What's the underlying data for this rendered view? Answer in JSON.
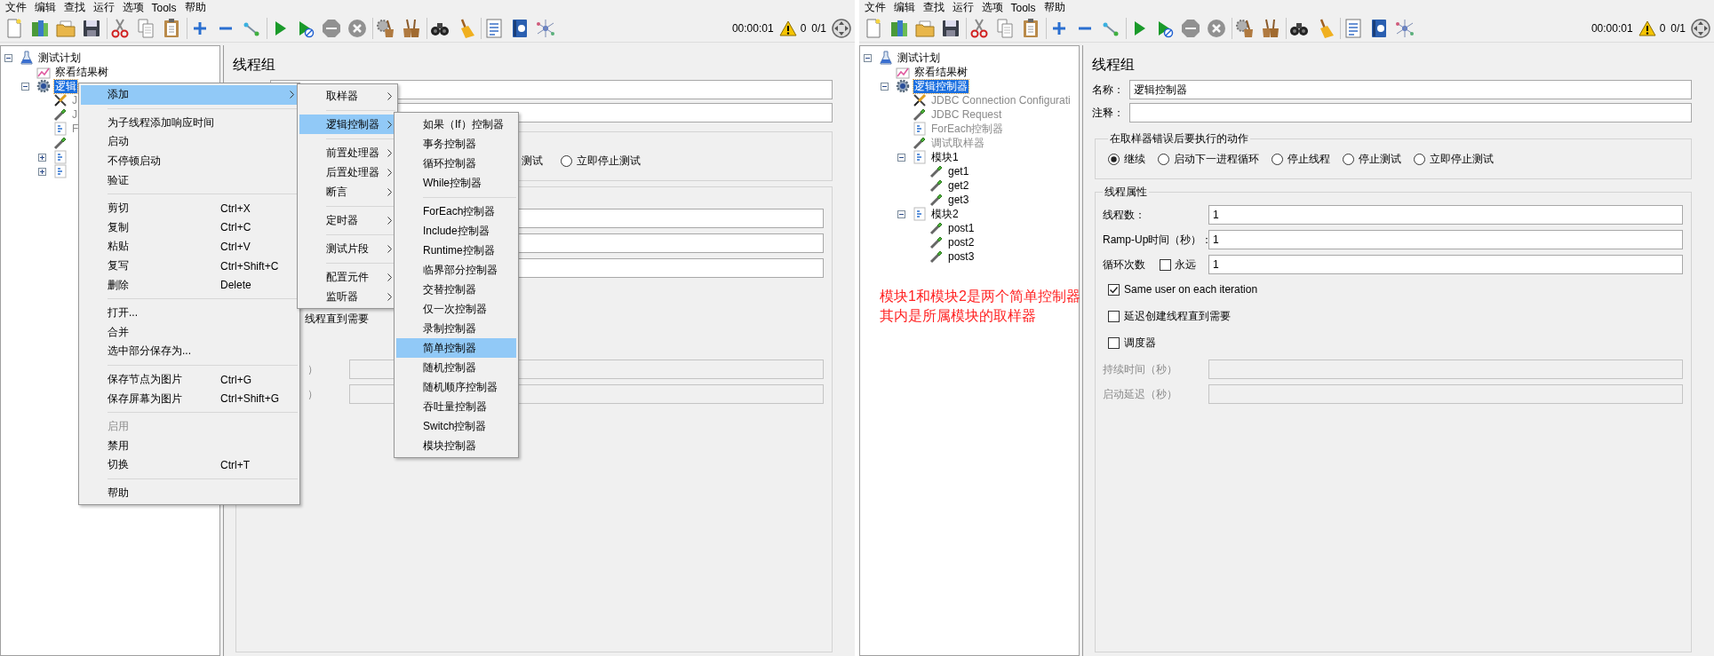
{
  "windows": [
    {
      "menu_bar": [
        "文件",
        "编辑",
        "查找",
        "运行",
        "选项",
        "Tools",
        "帮助"
      ],
      "toolbar": [
        {
          "kind": "new",
          "disabled": false
        },
        {
          "kind": "templates",
          "disabled": false
        },
        {
          "kind": "open",
          "disabled": false
        },
        {
          "kind": "save",
          "disabled": false
        },
        {
          "kind": "separator"
        },
        {
          "kind": "cut",
          "disabled": false
        },
        {
          "kind": "copy",
          "disabled": false
        },
        {
          "kind": "paste",
          "disabled": false
        },
        {
          "kind": "separator"
        },
        {
          "kind": "add",
          "disabled": false
        },
        {
          "kind": "remove",
          "disabled": false
        },
        {
          "kind": "toggle",
          "disabled": false
        },
        {
          "kind": "separator"
        },
        {
          "kind": "start",
          "disabled": false
        },
        {
          "kind": "start_no_pause",
          "disabled": false
        },
        {
          "kind": "stop",
          "disabled": true
        },
        {
          "kind": "shutdown",
          "disabled": true
        },
        {
          "kind": "separator"
        },
        {
          "kind": "clear",
          "disabled": false
        },
        {
          "kind": "clear_all",
          "disabled": false
        },
        {
          "kind": "separator"
        },
        {
          "kind": "search",
          "disabled": false
        },
        {
          "kind": "reset_search",
          "disabled": false
        },
        {
          "kind": "separator"
        },
        {
          "kind": "function_helper",
          "disabled": false
        },
        {
          "kind": "help",
          "disabled": false
        },
        {
          "kind": "network",
          "disabled": false
        }
      ],
      "timer": "00:00:01",
      "error_count": "0",
      "thread_count": "0/1",
      "tree": [
        {
          "label": "测试计划",
          "kind": "plan",
          "expanded": true,
          "selected": false,
          "disabled": false,
          "children": [
            {
              "label": "察看结果树",
              "kind": "listener",
              "selected": false,
              "disabled": false
            },
            {
              "label": "逻辑",
              "kind": "group",
              "expanded": true,
              "selected": true,
              "disabled": false,
              "children": [
                {
                  "label": "J",
                  "kind": "config",
                  "selected": false,
                  "disabled": true
                },
                {
                  "label": "J",
                  "kind": "sampler",
                  "selected": false,
                  "disabled": true
                },
                {
                  "label": "F",
                  "kind": "controller",
                  "selected": false,
                  "disabled": true
                },
                {
                  "kind": "sampler"
                },
                {
                  "kind": "controller",
                  "expanded": false
                },
                {
                  "kind": "controller",
                  "expanded": false
                }
              ]
            }
          ]
        }
      ],
      "panel": {
        "title": "线程组",
        "covered": true,
        "fields": [
          {
            "disabled": false
          },
          {
            "disabled": false
          }
        ],
        "error_action": {
          "lead": "测试",
          "options": [
            {
              "label": "立即停止测试",
              "selected": false
            }
          ]
        },
        "thread_properties": {
          "rows": [
            {
              "kind": "field",
              "disabled": false
            },
            {
              "kind": "field",
              "disabled": false
            },
            {
              "kind": "field",
              "disabled": false
            },
            {
              "kind": "gap"
            },
            {
              "kind": "text",
              "label": "线程直到需要"
            },
            {
              "kind": "gap"
            },
            {
              "kind": "field",
              "label": "）",
              "disabled": true
            },
            {
              "kind": "field",
              "label": "）",
              "disabled": true
            }
          ]
        }
      },
      "context_menus": [
        {
          "items": [
            {
              "kind": "item",
              "label": "添加",
              "submenu": true,
              "selected": true,
              "disabled": false
            },
            {
              "kind": "separator"
            },
            {
              "kind": "item",
              "label": "为子线程添加响应时间",
              "selected": false,
              "disabled": false
            },
            {
              "kind": "item",
              "label": "启动",
              "selected": false,
              "disabled": false
            },
            {
              "kind": "item",
              "label": "不停顿启动",
              "selected": false,
              "disabled": false
            },
            {
              "kind": "item",
              "label": "验证",
              "selected": false,
              "disabled": false
            },
            {
              "kind": "separator"
            },
            {
              "kind": "item",
              "label": "剪切",
              "shortcut": "Ctrl+X",
              "selected": false,
              "disabled": false
            },
            {
              "kind": "item",
              "label": "复制",
              "shortcut": "Ctrl+C",
              "selected": false,
              "disabled": false
            },
            {
              "kind": "item",
              "label": "粘贴",
              "shortcut": "Ctrl+V",
              "selected": false,
              "disabled": false
            },
            {
              "kind": "item",
              "label": "复写",
              "shortcut": "Ctrl+Shift+C",
              "selected": false,
              "disabled": false
            },
            {
              "kind": "item",
              "label": "删除",
              "shortcut": "Delete",
              "selected": false,
              "disabled": false
            },
            {
              "kind": "separator"
            },
            {
              "kind": "item",
              "label": "打开...",
              "selected": false,
              "disabled": false
            },
            {
              "kind": "item",
              "label": "合并",
              "selected": false,
              "disabled": false
            },
            {
              "kind": "item",
              "label": "选中部分保存为...",
              "selected": false,
              "disabled": false
            },
            {
              "kind": "separator"
            },
            {
              "kind": "item",
              "label": "保存节点为图片",
              "shortcut": "Ctrl+G",
              "selected": false,
              "disabled": false
            },
            {
              "kind": "item",
              "label": "保存屏幕为图片",
              "shortcut": "Ctrl+Shift+G",
              "selected": false,
              "disabled": false
            },
            {
              "kind": "separator"
            },
            {
              "kind": "item",
              "label": "启用",
              "selected": false,
              "disabled": true
            },
            {
              "kind": "item",
              "label": "禁用",
              "selected": false,
              "disabled": false
            },
            {
              "kind": "item",
              "label": "切换",
              "shortcut": "Ctrl+T",
              "selected": false,
              "disabled": false
            },
            {
              "kind": "separator"
            },
            {
              "kind": "item",
              "label": "帮助",
              "selected": false,
              "disabled": false
            }
          ]
        },
        {
          "items": [
            {
              "kind": "item",
              "label": "取样器",
              "submenu": true,
              "selected": false
            },
            {
              "kind": "separator"
            },
            {
              "kind": "item",
              "label": "逻辑控制器",
              "submenu": true,
              "selected": true
            },
            {
              "kind": "separator"
            },
            {
              "kind": "item",
              "label": "前置处理器",
              "submenu": true,
              "selected": false
            },
            {
              "kind": "item",
              "label": "后置处理器",
              "submenu": true,
              "selected": false
            },
            {
              "kind": "item",
              "label": "断言",
              "submenu": true,
              "selected": false
            },
            {
              "kind": "separator"
            },
            {
              "kind": "item",
              "label": "定时器",
              "submenu": true,
              "selected": false
            },
            {
              "kind": "separator"
            },
            {
              "kind": "item",
              "label": "测试片段",
              "submenu": true,
              "selected": false
            },
            {
              "kind": "separator"
            },
            {
              "kind": "item",
              "label": "配置元件",
              "submenu": true,
              "selected": false
            },
            {
              "kind": "item",
              "label": "监听器",
              "submenu": true,
              "selected": false
            }
          ]
        },
        {
          "items": [
            {
              "kind": "item",
              "label": "如果（If）控制器",
              "selected": false
            },
            {
              "kind": "item",
              "label": "事务控制器",
              "selected": false
            },
            {
              "kind": "item",
              "label": "循环控制器",
              "selected": false
            },
            {
              "kind": "item",
              "label": "While控制器",
              "selected": false
            },
            {
              "kind": "separator"
            },
            {
              "kind": "item",
              "label": "ForEach控制器",
              "selected": false
            },
            {
              "kind": "item",
              "label": "Include控制器",
              "selected": false
            },
            {
              "kind": "item",
              "label": "Runtime控制器",
              "selected": false
            },
            {
              "kind": "item",
              "label": "临界部分控制器",
              "selected": false
            },
            {
              "kind": "item",
              "label": "交替控制器",
              "selected": false
            },
            {
              "kind": "item",
              "label": "仅一次控制器",
              "selected": false
            },
            {
              "kind": "item",
              "label": "录制控制器",
              "selected": false
            },
            {
              "kind": "item",
              "label": "简单控制器",
              "selected": true
            },
            {
              "kind": "item",
              "label": "随机控制器",
              "selected": false
            },
            {
              "kind": "item",
              "label": "随机顺序控制器",
              "selected": false
            },
            {
              "kind": "item",
              "label": "吞吐量控制器",
              "selected": false
            },
            {
              "kind": "item",
              "label": "Switch控制器",
              "selected": false
            },
            {
              "kind": "item",
              "label": "模块控制器",
              "selected": false
            }
          ]
        }
      ]
    },
    {
      "menu_bar": [
        "文件",
        "编辑",
        "查找",
        "运行",
        "选项",
        "Tools",
        "帮助"
      ],
      "toolbar": [
        {
          "kind": "new",
          "disabled": false
        },
        {
          "kind": "templates",
          "disabled": false
        },
        {
          "kind": "open",
          "disabled": false
        },
        {
          "kind": "save",
          "disabled": false
        },
        {
          "kind": "separator"
        },
        {
          "kind": "cut",
          "disabled": false
        },
        {
          "kind": "copy",
          "disabled": false
        },
        {
          "kind": "paste",
          "disabled": false
        },
        {
          "kind": "separator"
        },
        {
          "kind": "add",
          "disabled": false
        },
        {
          "kind": "remove",
          "disabled": false
        },
        {
          "kind": "toggle",
          "disabled": false
        },
        {
          "kind": "separator"
        },
        {
          "kind": "start",
          "disabled": false
        },
        {
          "kind": "start_no_pause",
          "disabled": false
        },
        {
          "kind": "stop",
          "disabled": true
        },
        {
          "kind": "shutdown",
          "disabled": true
        },
        {
          "kind": "separator"
        },
        {
          "kind": "clear",
          "disabled": false
        },
        {
          "kind": "clear_all",
          "disabled": false
        },
        {
          "kind": "separator"
        },
        {
          "kind": "search",
          "disabled": false
        },
        {
          "kind": "reset_search",
          "disabled": false
        },
        {
          "kind": "separator"
        },
        {
          "kind": "function_helper",
          "disabled": false
        },
        {
          "kind": "help",
          "disabled": false
        },
        {
          "kind": "network",
          "disabled": false
        }
      ],
      "timer": "00:00:01",
      "error_count": "0",
      "thread_count": "0/1",
      "tree": [
        {
          "label": "测试计划",
          "kind": "plan",
          "expanded": true,
          "selected": false,
          "disabled": false,
          "children": [
            {
              "label": "察看结果树",
              "kind": "listener",
              "selected": false,
              "disabled": false
            },
            {
              "label": "逻辑控制器",
              "kind": "group",
              "expanded": true,
              "selected": true,
              "disabled": false,
              "children": [
                {
                  "label": "JDBC Connection Configurati",
                  "kind": "config",
                  "selected": false,
                  "disabled": true
                },
                {
                  "label": "JDBC Request",
                  "kind": "sampler",
                  "selected": false,
                  "disabled": true
                },
                {
                  "label": "ForEach控制器",
                  "kind": "controller",
                  "selected": false,
                  "disabled": true
                },
                {
                  "label": "调试取样器",
                  "kind": "sampler",
                  "selected": false,
                  "disabled": true
                },
                {
                  "label": "模块1",
                  "kind": "controller",
                  "expanded": true,
                  "selected": false,
                  "disabled": false,
                  "children": [
                    {
                      "label": "get1",
                      "kind": "sampler",
                      "selected": false,
                      "disabled": false
                    },
                    {
                      "label": "get2",
                      "kind": "sampler",
                      "selected": false,
                      "disabled": false
                    },
                    {
                      "label": "get3",
                      "kind": "sampler",
                      "selected": false,
                      "disabled": false
                    }
                  ]
                },
                {
                  "label": "模块2",
                  "kind": "controller",
                  "expanded": true,
                  "selected": false,
                  "disabled": false,
                  "children": [
                    {
                      "label": "post1",
                      "kind": "sampler",
                      "selected": false,
                      "disabled": false
                    },
                    {
                      "label": "post2",
                      "kind": "sampler",
                      "selected": false,
                      "disabled": false
                    },
                    {
                      "label": "post3",
                      "kind": "sampler",
                      "selected": false,
                      "disabled": false
                    }
                  ]
                }
              ]
            }
          ]
        }
      ],
      "panel": {
        "title": "线程组",
        "fields": [
          {
            "label": "名称：",
            "value": "逻辑控制器",
            "disabled": false
          },
          {
            "label": "注释：",
            "disabled": false
          }
        ],
        "error_action": {
          "title": "在取样器错误后要执行的动作",
          "options": [
            {
              "label": "继续",
              "selected": true
            },
            {
              "label": "启动下一进程循环",
              "selected": false
            },
            {
              "label": "停止线程",
              "selected": false
            },
            {
              "label": "停止测试",
              "selected": false
            },
            {
              "label": "立即停止测试",
              "selected": false
            }
          ]
        },
        "thread_properties": {
          "title": "线程属性",
          "rows": [
            {
              "kind": "field",
              "label": "线程数：",
              "value": "1",
              "disabled": false
            },
            {
              "kind": "field",
              "label": "Ramp-Up时间（秒）：",
              "value": "1",
              "disabled": false
            },
            {
              "kind": "field",
              "label": "循环次数",
              "value": "1",
              "disabled": false,
              "option": {
                "label": "永远",
                "checked": false
              }
            },
            {
              "kind": "check",
              "label": "Same user on each iteration",
              "checked": true
            },
            {
              "kind": "check",
              "label": "延迟创建线程直到需要",
              "checked": false
            },
            {
              "kind": "check",
              "label": "调度器",
              "checked": false
            },
            {
              "kind": "field",
              "label": "持续时间（秒）",
              "disabled": true
            },
            {
              "kind": "field",
              "label": "启动延迟（秒）",
              "disabled": true
            }
          ]
        }
      },
      "annotation": [
        "模块1和模块2是两个简单控制器",
        "其内是所属模块的取样器"
      ]
    }
  ]
}
